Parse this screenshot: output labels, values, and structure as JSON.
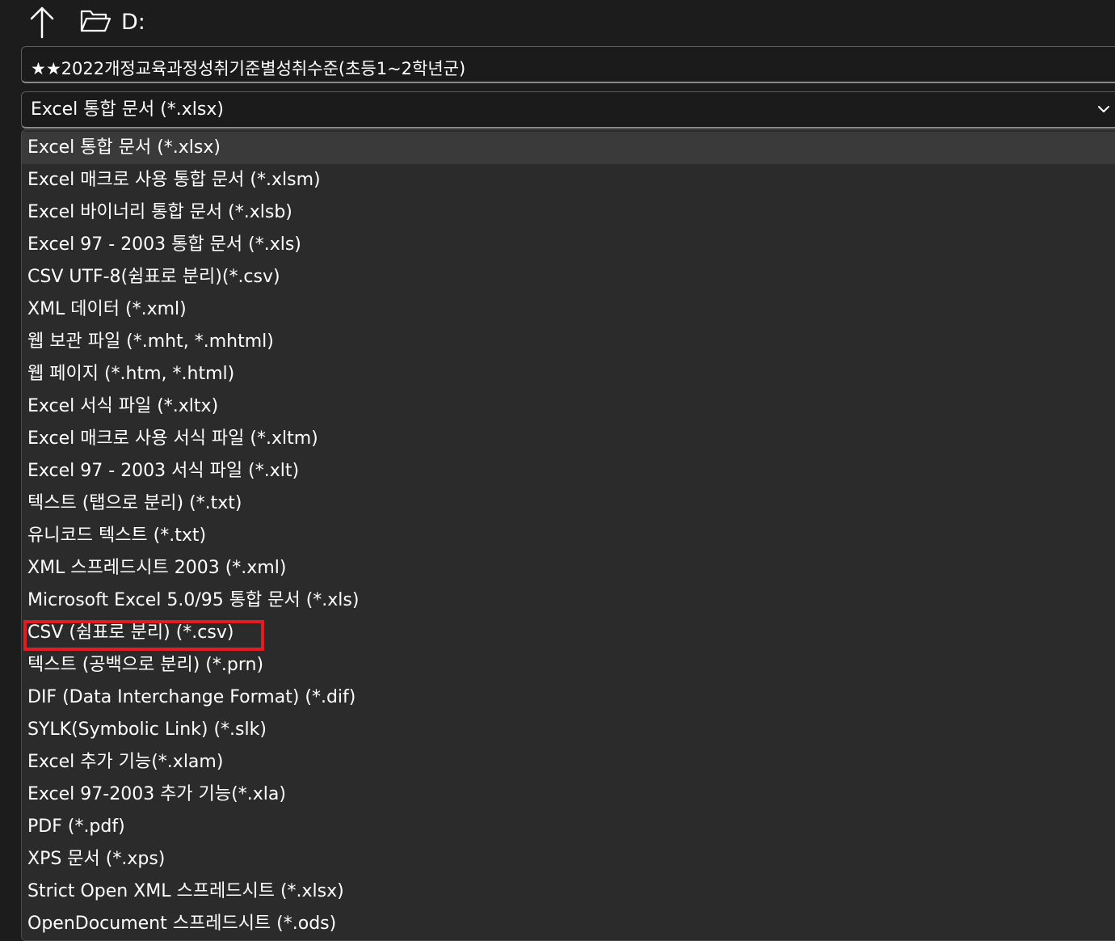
{
  "navigation": {
    "up_icon": "arrow-up-icon",
    "folder_icon": "folder-open-icon",
    "current_path": "D:"
  },
  "filename": {
    "value": "★★2022개정교육과정성취기준별성취수준(초등1~2학년군)"
  },
  "filetype": {
    "selected": "Excel 통합 문서 (*.xlsx)",
    "chevron_icon": "chevron-down-icon",
    "options": [
      "Excel 통합 문서 (*.xlsx)",
      "Excel 매크로 사용 통합 문서 (*.xlsm)",
      "Excel 바이너리 통합 문서 (*.xlsb)",
      "Excel 97 - 2003 통합 문서 (*.xls)",
      "CSV UTF-8(쉼표로 분리)(*.csv)",
      "XML 데이터 (*.xml)",
      "웹 보관 파일 (*.mht, *.mhtml)",
      "웹 페이지 (*.htm, *.html)",
      "Excel 서식 파일 (*.xltx)",
      "Excel 매크로 사용 서식 파일 (*.xltm)",
      "Excel 97 - 2003 서식 파일 (*.xlt)",
      "텍스트 (탭으로 분리) (*.txt)",
      "유니코드 텍스트 (*.txt)",
      "XML 스프레드시트 2003 (*.xml)",
      "Microsoft Excel 5.0/95 통합 문서 (*.xls)",
      "CSV (쉼표로 분리) (*.csv)",
      "텍스트 (공백으로 분리) (*.prn)",
      "DIF (Data Interchange Format) (*.dif)",
      "SYLK(Symbolic Link) (*.slk)",
      "Excel 추가 기능(*.xlam)",
      "Excel 97-2003 추가 기능(*.xla)",
      "PDF (*.pdf)",
      "XPS 문서 (*.xps)",
      "Strict Open XML 스프레드시트 (*.xlsx)",
      "OpenDocument 스프레드시트 (*.ods)"
    ],
    "selected_index": 0,
    "annotated_index": 15
  },
  "colors": {
    "background": "#1c1c1c",
    "list_background": "#2b2b2b",
    "selected_row": "#3a3a3a",
    "annotation_red": "#e31b23",
    "text": "#ffffff"
  }
}
